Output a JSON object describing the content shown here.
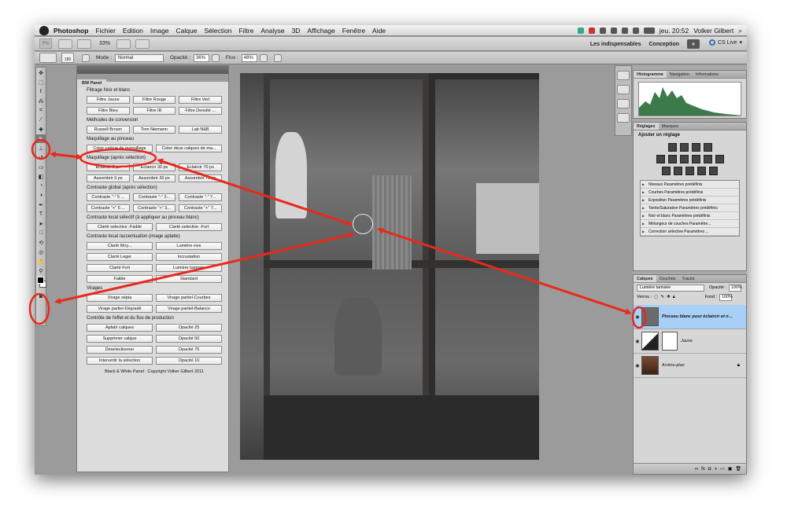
{
  "menubar": {
    "app_name": "Photoshop",
    "items": [
      "Fichier",
      "Edition",
      "Image",
      "Calque",
      "Sélection",
      "Filtre",
      "Analyse",
      "3D",
      "Affichage",
      "Fenêtre",
      "Aide"
    ],
    "clock": "jeu. 20:52",
    "user": "Volker Gilbert"
  },
  "appbar": {
    "zoom": "33%",
    "workspaces": [
      "Les indispensables",
      "Conception"
    ],
    "cs_live": "CS Live"
  },
  "options_bar": {
    "brush_size": "189",
    "mode_label": "Mode :",
    "mode_value": "Normal",
    "opacity_label": "Opacité :",
    "opacity_value": "36%",
    "flow_label": "Flux :",
    "flow_value": "48%"
  },
  "bw_panel": {
    "tab": "BW Panel",
    "sections": [
      {
        "title": "Filtrage Noir et blanc",
        "rows": [
          [
            "Filtre Jaune",
            "Filtre Rouge",
            "Filtre Vert"
          ],
          [
            "Filtre Bleu",
            "Filtre IR",
            "Filtre Densité ..."
          ]
        ]
      },
      {
        "title": "Méthodes de conversion",
        "rows": [
          [
            "Russell Brown",
            "Tom Niemann",
            "Lab N&B"
          ]
        ]
      },
      {
        "title": "Maquillage au pinceau",
        "rows": [
          [
            "Créer calque de maquillage",
            "Créer deux calques de ma..."
          ]
        ]
      },
      {
        "title": "Maquillage (après sélection)",
        "rows": [
          [
            "Eclaircir 5 px",
            "Eclaircir 30 px",
            "Eclaircir 70 px"
          ],
          [
            "Assombrir 5 px",
            "Assombrir 30 px",
            "Assombrir 70 px"
          ]
        ]
      },
      {
        "title": "Contraste global (après sélection)",
        "rows": [
          [
            "Contraste \"-\" 5 ...",
            "Contraste \"-\" 3...",
            "Contraste \"-\" 7..."
          ],
          [
            "Contraste \"+\" 5 ...",
            "Contraste \"+\" 3...",
            "Contraste \"+\" 7..."
          ]
        ]
      },
      {
        "title": "Contraste local sélectif (à appliquer au pinceau blanc)",
        "rows": [
          [
            "Clarté selective -Faible",
            "Clarté selective -Fort"
          ]
        ]
      },
      {
        "title": "Contraste local /accentuation (image aplatie)",
        "rows": [
          [
            "Clarté Moy...",
            "Lumière vive"
          ],
          [
            "Clarté Leger",
            "Incrustation"
          ],
          [
            "Clarté Fort",
            "Lumière tamisée"
          ],
          [
            "Faible",
            "Standard"
          ]
        ]
      },
      {
        "title": "Virages",
        "rows": [
          [
            "Virage sépia",
            "Virage partiel-Courbes"
          ],
          [
            "Virage partiel-Dégradé",
            "Virage partiel-Balance"
          ]
        ]
      },
      {
        "title": "Contrôle de l'effet et du flux de production",
        "rows": [
          [
            "Aplatir calques",
            "Opacité 25"
          ],
          [
            "Supprimer calque",
            "Opacité 50"
          ],
          [
            "Déselectionner",
            "Opacité 75"
          ],
          [
            "Intervertir la sélection",
            "Opacité 10"
          ]
        ]
      }
    ],
    "footer": "Black & White Panel : Copyright Volker Gilbert 2011"
  },
  "right_panels": {
    "histogram_tabs": [
      "Histogramme",
      "Navigation",
      "Informations"
    ],
    "adjust_tabs": [
      "Réglages",
      "Masques"
    ],
    "adjust_title": "Ajouter un réglage",
    "presets": [
      "Niveaux Paramètres prédéfinis",
      "Courbes Paramètres prédéfinis",
      "Exposition Paramètres prédéfinis",
      "Teinte/Saturation Paramètres prédéfinis",
      "Noir et blanc Paramètres prédéfinis",
      "Mélangeur de couches Paramètre...",
      "Correction sélective Paramètres ..."
    ],
    "layers_tabs": [
      "Calques",
      "Couches",
      "Tracés"
    ],
    "blend_mode": "Lumière tamisée",
    "opacity_label": "Opacité :",
    "opacity_value": "100%",
    "lock_label": "Verrou :",
    "fill_label": "Fond :",
    "fill_value": "100%",
    "layers": [
      {
        "name": "Pinceau blanc pour éclaircir et noi...",
        "selected": true
      },
      {
        "name": "Jaune",
        "selected": false
      },
      {
        "name": "Arrière-plan",
        "selected": false
      }
    ]
  },
  "colors": {
    "accent_red": "#e8291c",
    "selection_blue": "#a8cff5",
    "histogram_green": "#3d7a4a"
  }
}
